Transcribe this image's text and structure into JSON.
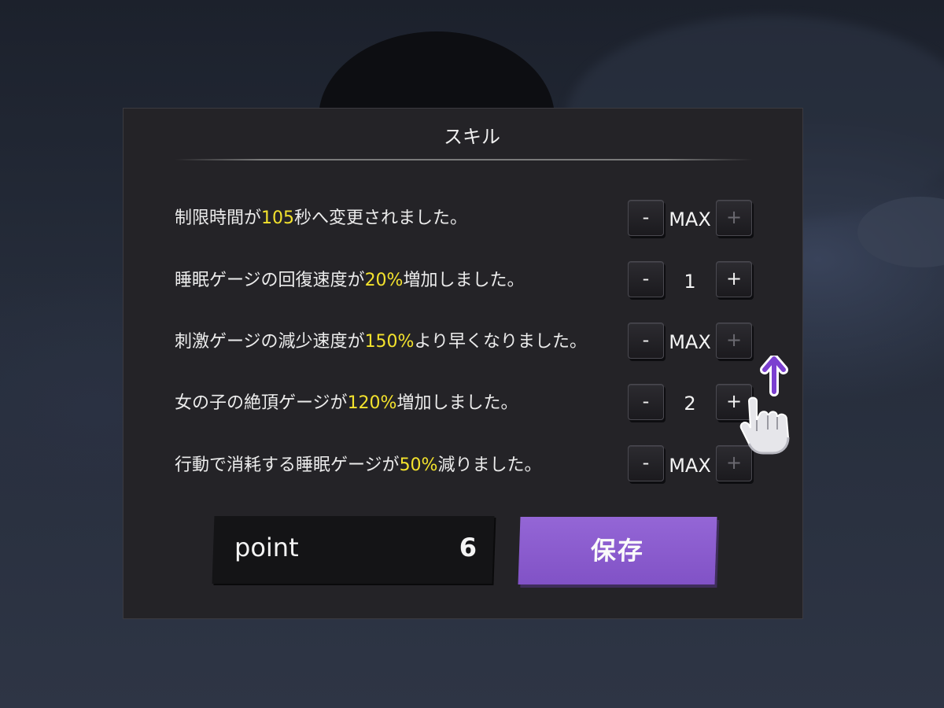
{
  "dialog": {
    "title": "スキル"
  },
  "skills": [
    {
      "text_before": "制限時間が",
      "highlight": "105",
      "text_after": "秒へ変更されました。",
      "level": "MAX",
      "minus_label": "-",
      "plus_label": "+",
      "plus_enabled": false
    },
    {
      "text_before": "睡眠ゲージの回復速度が",
      "highlight": "20%",
      "text_after": "増加しました。",
      "level": "1",
      "minus_label": "-",
      "plus_label": "+",
      "plus_enabled": true
    },
    {
      "text_before": "刺激ゲージの減少速度が",
      "highlight": "150%",
      "text_after": "より早くなりました。",
      "level": "MAX",
      "minus_label": "-",
      "plus_label": "+",
      "plus_enabled": false
    },
    {
      "text_before": "女の子の絶頂ゲージが",
      "highlight": "120%",
      "text_after": "増加しました。",
      "level": "2",
      "minus_label": "-",
      "plus_label": "+",
      "plus_enabled": true
    },
    {
      "text_before": "行動で消耗する睡眠ゲージが",
      "highlight": "50%",
      "text_after": "減りました。",
      "level": "MAX",
      "minus_label": "-",
      "plus_label": "+",
      "plus_enabled": false
    }
  ],
  "points": {
    "label": "point",
    "value": "6"
  },
  "save_button": {
    "label": "保存"
  },
  "colors": {
    "highlight": "#f3e22d",
    "accent": "#8c5fd1",
    "panel": "#242327"
  },
  "overlay_icons": [
    "arrow-up-icon",
    "hand-pointer-icon"
  ]
}
